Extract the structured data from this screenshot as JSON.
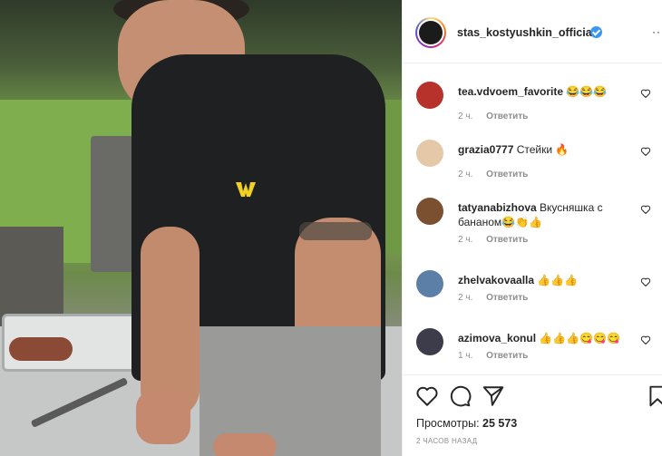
{
  "post": {
    "author": "stas_kostyushkin_official",
    "verified": true,
    "more_label": "··",
    "views_label": "Просмотры:",
    "views_value": "25 573",
    "time_ago": "2 часов назад"
  },
  "comments": [
    {
      "user": "tea.vdvoem_favorite",
      "text": "😂😂😂",
      "time": "2 ч.",
      "reply": "Ответить",
      "avatar_color": "#b6322a"
    },
    {
      "user": "grazia0777",
      "text": "Стейки 🔥",
      "time": "2 ч.",
      "reply": "Ответить",
      "avatar_color": "#e4c8a8"
    },
    {
      "user": "tatyanabizhova",
      "text": "Вкусняшка с бананом😂👏👍",
      "time": "2 ч.",
      "reply": "Ответить",
      "avatar_color": "#7a5030"
    },
    {
      "user": "zhelvakovaalla",
      "text": "👍👍👍",
      "time": "2 ч.",
      "reply": "Ответить",
      "avatar_color": "#5b7fa6"
    },
    {
      "user": "azimova_konul",
      "text": "👍👍👍😋😋😋",
      "time": "1 ч.",
      "reply": "Ответить",
      "avatar_color": "#3c3c4a"
    }
  ],
  "icons": {
    "like": "heart-icon",
    "comment": "comment-bubble-icon",
    "share": "paper-plane-icon",
    "save": "bookmark-icon",
    "verified": "verified-badge-icon"
  },
  "colors": {
    "verified": "#3897f0",
    "secondary_text": "#8e8e8e",
    "border": "#efefef"
  }
}
